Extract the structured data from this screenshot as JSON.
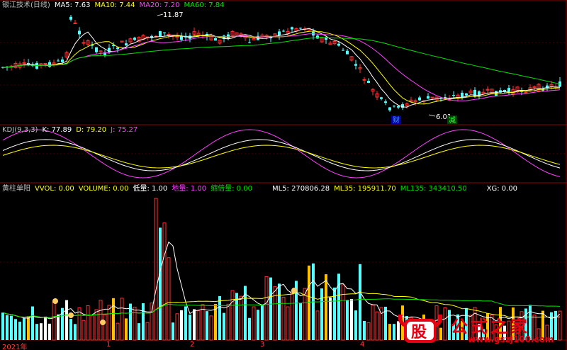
{
  "main_legend": {
    "title": "银江技术(日线)",
    "ma5": "MA5: 7.63",
    "ma10": "MA10: 7.44",
    "ma20": "MA20: 7.20",
    "ma60": "MA60: 7.84"
  },
  "annotations": {
    "high": "11.87",
    "low": "6.01",
    "badge_cai": "财",
    "badge_jian": "减"
  },
  "kdj_legend": {
    "title": "KDJ(9,3,3)",
    "k": "K: 77.89",
    "d": "D: 79.20",
    "j": "J: 75.27"
  },
  "vol_legend": {
    "title": "黄柱单阳",
    "vvol": "VVOL: 0.00",
    "volume": "VOLUME: 0.00",
    "low_vol": "低量: 1.00",
    "floor_vol": "地量: 1.00",
    "shrink": "缩倍量: 0.00",
    "ml5": "ML5: 270806.28",
    "ml35": "ML35: 195911.70",
    "ml135": "ML135: 343410.50",
    "xg": "XG: 0.00"
  },
  "x_axis": {
    "year": "2021年",
    "m1": "1",
    "m2": "2",
    "m3": "3",
    "m4": "4"
  },
  "watermark": {
    "text": "公式之家",
    "url": "www.gszj100.com",
    "logo_char": "股"
  },
  "colors": {
    "up": "#ff3232",
    "down": "#54ffff",
    "ma5": "#ffffff",
    "ma10": "#ffff00",
    "ma20": "#ff40ff",
    "ma60": "#00e000",
    "grid": "#8b0000"
  }
}
